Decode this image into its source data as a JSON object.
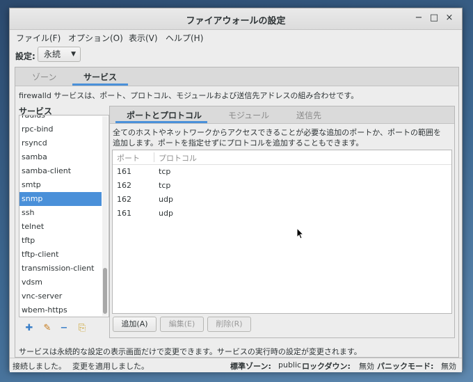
{
  "window": {
    "title": "ファイアウォールの設定"
  },
  "menu": [
    "ファイル(F)",
    "オプション(O)",
    "表示(V)",
    "ヘルプ(H)"
  ],
  "config": {
    "label": "設定:",
    "value": "永続"
  },
  "main_tabs": [
    "ゾーン",
    "サービス"
  ],
  "active_main_tab": 1,
  "services_description": "firewalld サービスは、ポート、プロトコル、モジュールおよび送信先アドレスの組み合わせです。",
  "services_label": "サービス",
  "services": [
    "radius",
    "rpc-bind",
    "rsyncd",
    "samba",
    "samba-client",
    "smtp",
    "snmp",
    "ssh",
    "telnet",
    "tftp",
    "tftp-client",
    "transmission-client",
    "vdsm",
    "vnc-server",
    "wbem-https"
  ],
  "selected_service": "snmp",
  "inner_tabs": [
    "ポートとプロトコル",
    "モジュール",
    "送信先"
  ],
  "active_inner_tab": 0,
  "ports_description_line1": "全てのホストやネットワークからアクセスできることが必要な追加のポートか、ポートの範囲を",
  "ports_description_line2": "追加します。ポートを指定せずにプロトコルを追加することもできます。",
  "ports_columns": [
    "ポート",
    "プロトコル"
  ],
  "ports": [
    {
      "port": "161",
      "protocol": "tcp"
    },
    {
      "port": "162",
      "protocol": "tcp"
    },
    {
      "port": "162",
      "protocol": "udp"
    },
    {
      "port": "161",
      "protocol": "udp"
    }
  ],
  "buttons": {
    "add": "追加(A)",
    "edit": "編集(E)",
    "remove": "削除(R)"
  },
  "bottom_note": "サービスは永続的な設定の表示画面だけで変更できます。サービスの実行時の設定が変更されます。",
  "status": {
    "connection": "接続しました。",
    "applied": "変更を適用しました。",
    "default_zone_label": "標準ゾーン:",
    "default_zone_value": "public",
    "lockdown_label": "ロックダウン:",
    "lockdown_value": "無効",
    "panic_label": "パニックモード:",
    "panic_value": "無効"
  },
  "window_controls": {
    "minimize": "−",
    "maximize": "□",
    "close": "×"
  },
  "colors": {
    "accent": "#4a90d9"
  }
}
